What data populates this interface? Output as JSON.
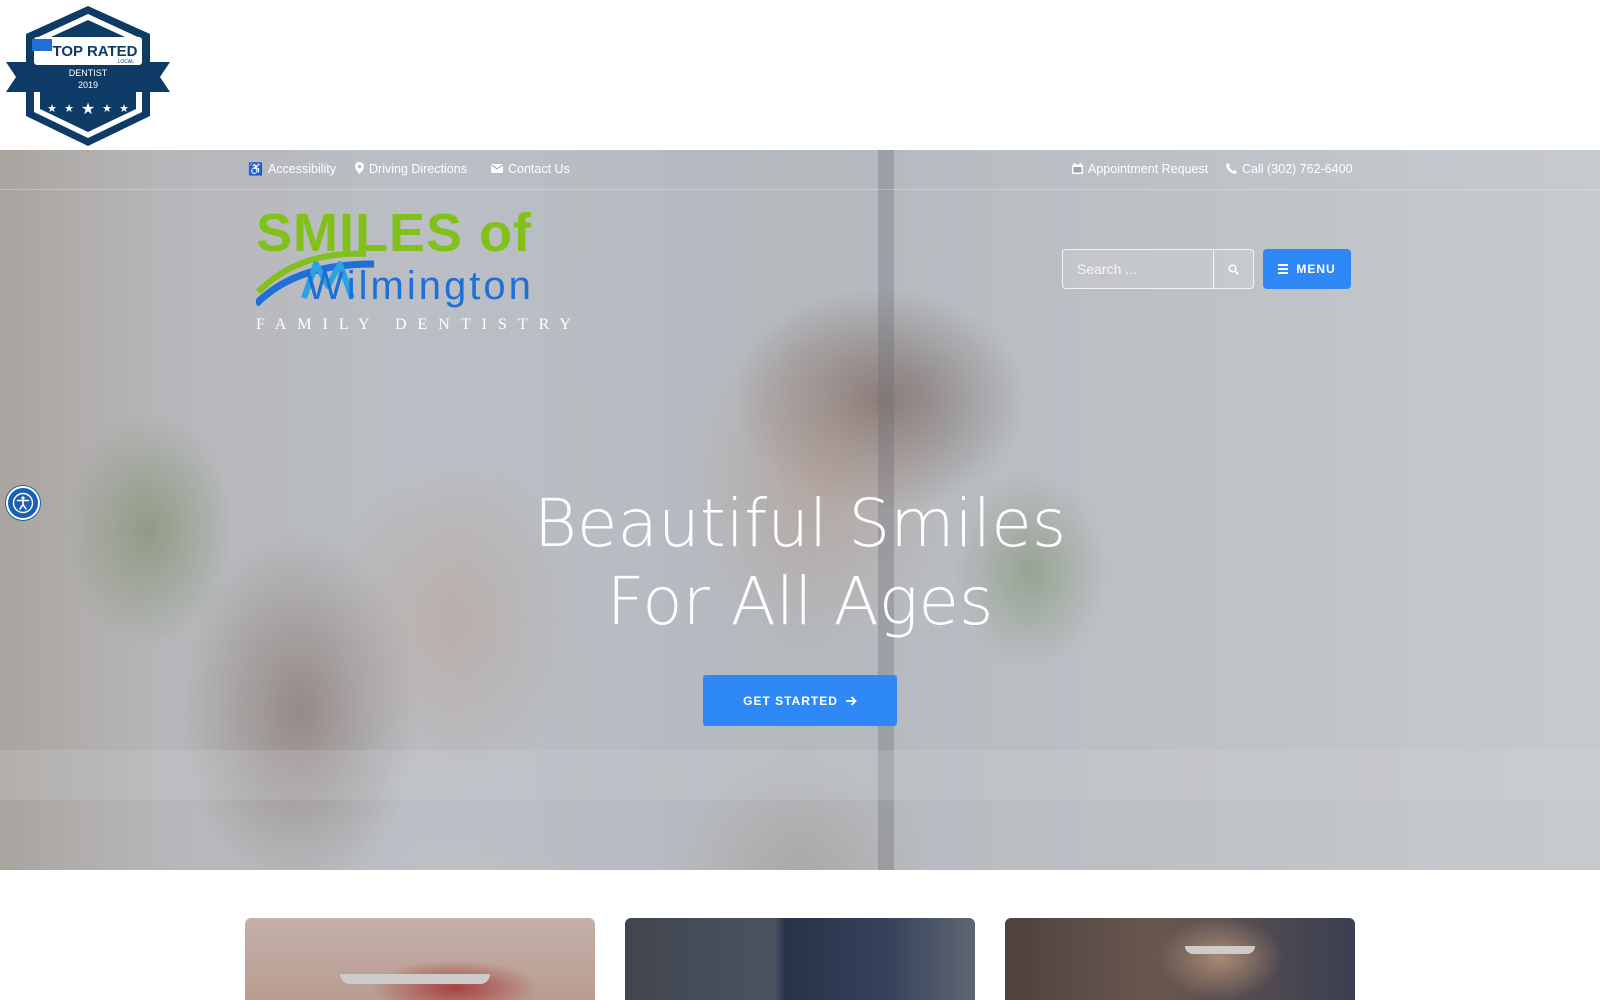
{
  "badge": {
    "title": "TOP RATED",
    "subtitle": "LOCAL",
    "category": "DENTIST",
    "year": "2019"
  },
  "utility_nav": {
    "accessibility": "Accessibility",
    "directions": "Driving Directions",
    "contact": "Contact Us",
    "appointment": "Appointment Request",
    "call": "Call (302) 762-6400"
  },
  "logo": {
    "line1": "SMILES of",
    "line2": "Wilmington",
    "tagline": "FAMILY DENTISTRY"
  },
  "search": {
    "placeholder": "Search ..."
  },
  "menu_button": {
    "label": "MENU"
  },
  "hero": {
    "headline_line1": "Beautiful Smiles",
    "headline_line2": "For All Ages",
    "cta_label": "GET STARTED"
  },
  "colors": {
    "accent": "#2e88f6",
    "logo_green": "#82c01c",
    "logo_blue": "#1f6fd6",
    "badge_navy": "#0e3b66"
  },
  "icons": [
    "accessibility-icon",
    "map-marker-icon",
    "envelope-icon",
    "calendar-icon",
    "phone-icon",
    "search-icon",
    "hamburger-icon",
    "arrow-right-icon",
    "accessibility-widget-icon"
  ]
}
